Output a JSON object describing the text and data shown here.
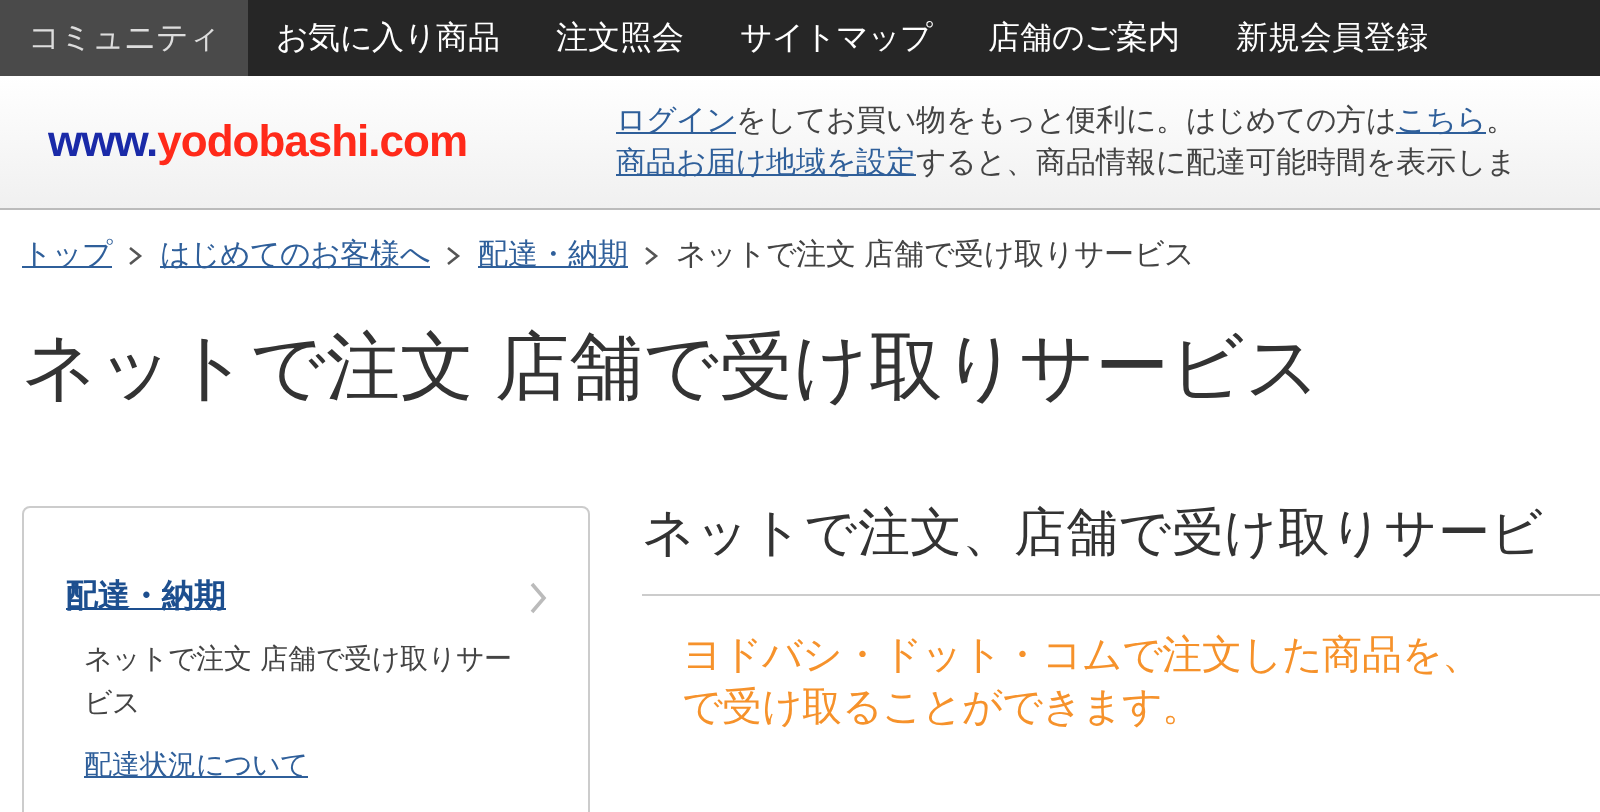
{
  "top_nav": [
    {
      "label": "コミュニティ",
      "selected": true
    },
    {
      "label": "お気に入り商品",
      "selected": false
    },
    {
      "label": "注文照会",
      "selected": false
    },
    {
      "label": "サイトマップ",
      "selected": false
    },
    {
      "label": "店舗のご案内",
      "selected": false
    },
    {
      "label": "新規会員登録",
      "selected": false
    }
  ],
  "header": {
    "logo": {
      "prefix": "www.",
      "name": "yodobashi.com"
    },
    "messages": [
      [
        {
          "text": "ログイン",
          "link": true
        },
        {
          "text": "をしてお買い物をもっと便利に。はじめての方は",
          "link": false
        },
        {
          "text": "こちら",
          "link": true
        },
        {
          "text": "。",
          "link": false
        }
      ],
      [
        {
          "text": "商品お届け地域を設定",
          "link": true
        },
        {
          "text": "すると、商品情報に配達可能時間を表示しま",
          "link": false
        }
      ]
    ]
  },
  "breadcrumb": [
    {
      "label": "トップ",
      "link": true
    },
    {
      "label": "はじめてのお客様へ",
      "link": true
    },
    {
      "label": "配達・納期",
      "link": true
    },
    {
      "label": "ネットで注文 店舗で受け取りサービス",
      "link": false
    }
  ],
  "page_title": "ネットで注文 店舗で受け取りサービス",
  "sidebar": {
    "heading": "配達・納期",
    "items": [
      {
        "label": "ネットで注文 店舗で受け取りサービス",
        "selected": true
      },
      {
        "label": "配達状況について",
        "selected": false
      }
    ]
  },
  "content": {
    "heading": "ネットで注文、店舗で受け取りサービ",
    "lead": [
      "ヨドバシ・ドット・コムで注文した商品を、",
      "で受け取ることができます。"
    ]
  }
}
